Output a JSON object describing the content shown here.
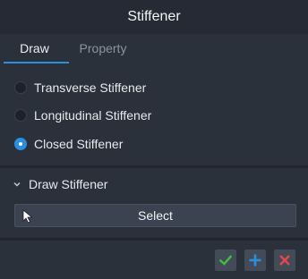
{
  "window": {
    "title": "Stiffener"
  },
  "tabs": [
    {
      "label": "Draw",
      "active": true
    },
    {
      "label": "Property",
      "active": false
    }
  ],
  "stiffener_types": {
    "options": [
      {
        "label": "Transverse Stiffener",
        "checked": false
      },
      {
        "label": "Longitudinal Stiffener",
        "checked": false
      },
      {
        "label": "Closed Stiffener",
        "checked": true
      }
    ]
  },
  "draw_section": {
    "title": "Draw Stiffener",
    "select_label": "Select"
  },
  "colors": {
    "accent": "#2b8fe0",
    "ok": "#3fbf3f",
    "add": "#2b8fe0",
    "cancel": "#e54848"
  },
  "icons": {
    "section_toggle": "chevron-down-icon",
    "select": "cursor-arrow-icon",
    "ok": "check-icon",
    "add": "plus-icon",
    "cancel": "close-icon"
  }
}
